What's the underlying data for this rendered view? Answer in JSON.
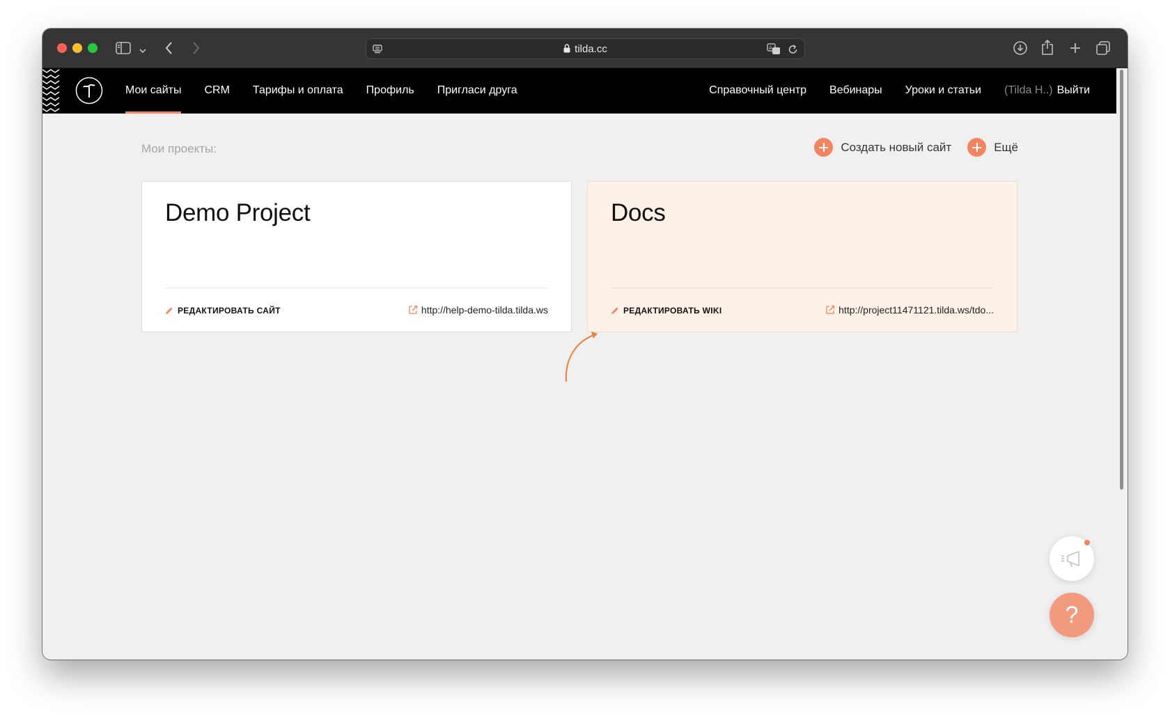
{
  "browser": {
    "url": "tilda.cc",
    "icons": [
      "sidebar-icon",
      "chevron-down-icon",
      "back-icon",
      "forward-icon",
      "reader-icon",
      "lock-icon",
      "translate-icon",
      "reload-icon",
      "download-icon",
      "share-icon",
      "new-tab-icon",
      "tabs-overview-icon"
    ]
  },
  "nav": {
    "logo_letter": "T",
    "left_items": [
      {
        "label": "Мои сайты",
        "active": true
      },
      {
        "label": "CRM"
      },
      {
        "label": "Тарифы и оплата"
      },
      {
        "label": "Профиль"
      },
      {
        "label": "Пригласи друга"
      }
    ],
    "right_items": [
      {
        "label": "Справочный центр"
      },
      {
        "label": "Вебинары"
      },
      {
        "label": "Уроки и статьи"
      }
    ],
    "user": "(Tilda H..)",
    "logout": "Выйти",
    "accent": "#f4845f"
  },
  "main": {
    "section_title": "Мои проекты:",
    "create_site": "Создать новый сайт",
    "more": "Ещё",
    "projects": [
      {
        "title": "Demo Project",
        "edit_label": "РЕДАКТИРОВАТЬ САЙТ",
        "link": "http://help-demo-tilda.tilda.ws",
        "background": "#ffffff"
      },
      {
        "title": "Docs",
        "edit_label": "РЕДАКТИРОВАТЬ WIKI",
        "link": "http://project11471121.tilda.ws/tdo...",
        "background": "#fcf1e7"
      }
    ]
  },
  "widgets": {
    "help_symbol": "?",
    "announce_icon": "megaphone-icon"
  }
}
